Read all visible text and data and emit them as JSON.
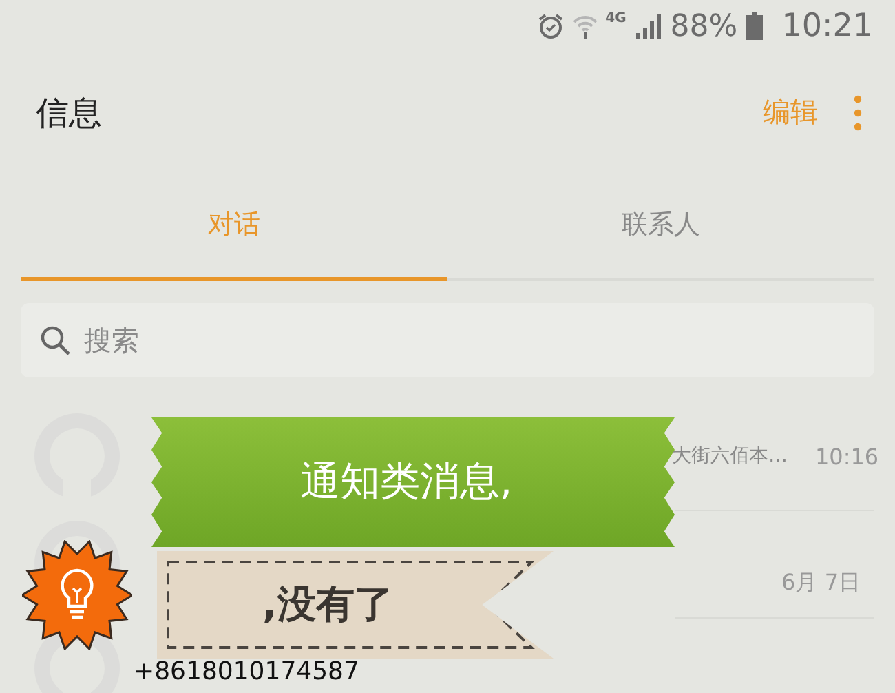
{
  "status_bar": {
    "network": "4G",
    "battery": "88%",
    "time": "10:21"
  },
  "header": {
    "title": "信息",
    "edit": "编辑"
  },
  "tabs": [
    {
      "label": "对话",
      "selected": true
    },
    {
      "label": "联系人",
      "selected": false
    }
  ],
  "search": {
    "placeholder": "搜索"
  },
  "conversations": [
    {
      "preview": "大街六佰本…",
      "time": "10:16"
    },
    {
      "time": "6月 7日"
    },
    {
      "name": "+8618010174587"
    }
  ],
  "overlays": [
    {
      "kind": "green-banner",
      "text": "通知类消息,"
    },
    {
      "kind": "tan-ribbon",
      "text": ",没有了"
    }
  ]
}
